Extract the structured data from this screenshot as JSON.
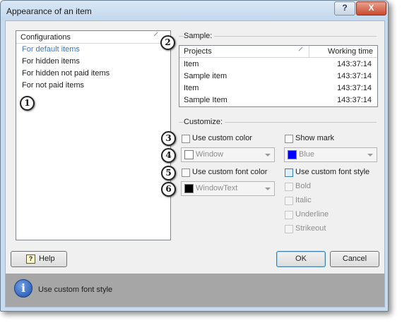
{
  "window": {
    "title": "Appearance of an item",
    "help_glyph": "?",
    "close_glyph": "X"
  },
  "configurations": {
    "header": "Configurations",
    "items": [
      "For default items",
      "For hidden items",
      "For hidden not paid items",
      "For not paid items"
    ],
    "selected_index": 0
  },
  "sample": {
    "group_title": "Sample:",
    "columns": [
      "Projects",
      "Working time"
    ],
    "rows": [
      [
        "Item",
        "143:37:14"
      ],
      [
        "Sample item",
        "143:37:14"
      ],
      [
        "Item",
        "143:37:14"
      ],
      [
        "Sample Item",
        "143:37:14"
      ]
    ]
  },
  "customize": {
    "group_title": "Customize:",
    "use_custom_color": {
      "label": "Use custom color",
      "checked": false
    },
    "color_combo": {
      "value": "Window",
      "swatch_color": "#ffffff",
      "enabled": false
    },
    "show_mark": {
      "label": "Show mark",
      "checked": false
    },
    "mark_combo": {
      "value": "Blue",
      "swatch_color": "#0000ff",
      "enabled": false
    },
    "use_custom_font_color": {
      "label": "Use custom font color",
      "checked": false
    },
    "font_color_combo": {
      "value": "WindowText",
      "swatch_color": "#000000",
      "enabled": false
    },
    "use_custom_font_style": {
      "label": "Use custom font style",
      "checked": false
    },
    "bold": {
      "label": "Bold",
      "enabled": false
    },
    "italic": {
      "label": "Italic",
      "enabled": false
    },
    "underline": {
      "label": "Underline",
      "enabled": false
    },
    "strikeout": {
      "label": "Strikeout",
      "enabled": false
    }
  },
  "markers": [
    "1",
    "2",
    "3",
    "4",
    "5",
    "6"
  ],
  "buttons": {
    "help": "Help",
    "help_icon": "?",
    "ok": "OK",
    "cancel": "Cancel"
  },
  "info": {
    "icon_glyph": "i",
    "text": "Use custom font style"
  }
}
